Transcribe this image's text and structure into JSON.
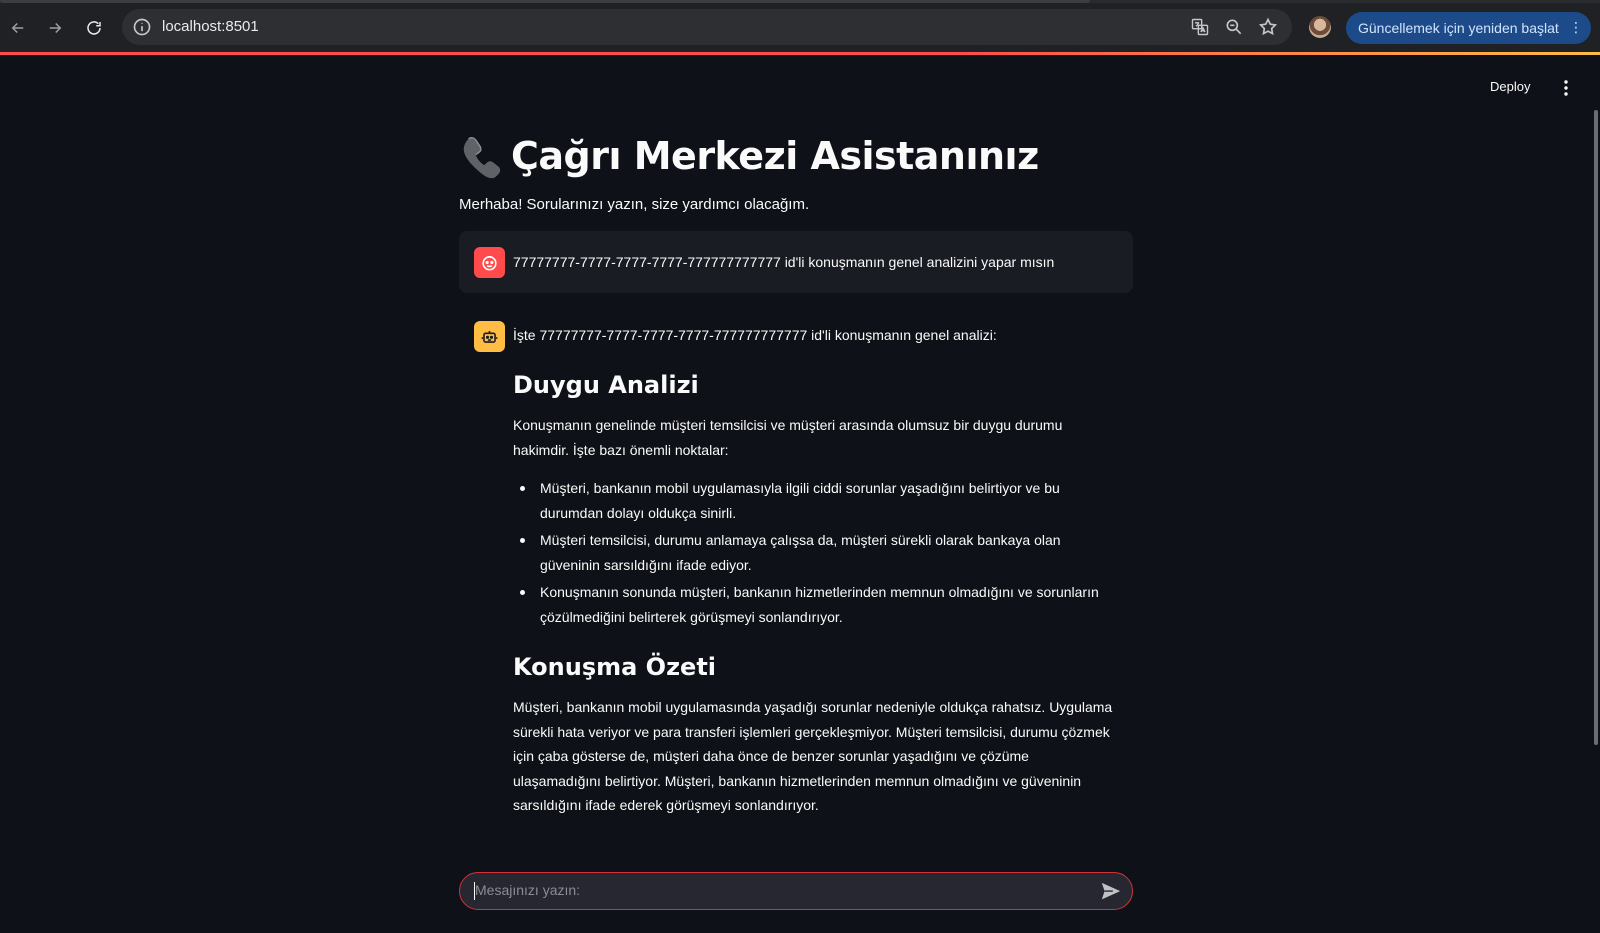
{
  "browser": {
    "url": "localhost:8501",
    "update_button": "Güncellemek için yeniden başlat"
  },
  "header": {
    "deploy_label": "Deploy"
  },
  "page": {
    "title": "Çağrı Merkezi Asistanınız",
    "intro": "Merhaba! Sorularınızı yazın, size yardımcı olacağım."
  },
  "messages": {
    "user": {
      "text": "77777777-7777-7777-7777-777777777777 id'li konuşmanın genel analizini yapar mısın"
    },
    "assistant": {
      "intro": "İşte 77777777-7777-7777-7777-777777777777 id'li konuşmanın genel analizi:",
      "section1_title": "Duygu Analizi",
      "section1_text": "Konuşmanın genelinde müşteri temsilcisi ve müşteri arasında olumsuz bir duygu durumu hakimdir. İşte bazı önemli noktalar:",
      "bullets": [
        "Müşteri, bankanın mobil uygulamasıyla ilgili ciddi sorunlar yaşadığını belirtiyor ve bu durumdan dolayı oldukça sinirli.",
        "Müşteri temsilcisi, durumu anlamaya çalışsa da, müşteri sürekli olarak bankaya olan güveninin sarsıldığını ifade ediyor.",
        "Konuşmanın sonunda müşteri, bankanın hizmetlerinden memnun olmadığını ve sorunların çözülmediğini belirterek görüşmeyi sonlandırıyor."
      ],
      "section2_title": "Konuşma Özeti",
      "section2_text": "Müşteri, bankanın mobil uygulamasında yaşadığı sorunlar nedeniyle oldukça rahatsız. Uygulama sürekli hata veriyor ve para transferi işlemleri gerçekleşmiyor. Müşteri temsilcisi, durumu çözmek için çaba gösterse de, müşteri daha önce de benzer sorunlar yaşadığını ve çözüme ulaşamadığını belirtiyor. Müşteri, bankanın hizmetlerinden memnun olmadığını ve güveninin sarsıldığını ifade ederek görüşmeyi sonlandırıyor."
    }
  },
  "chat_input": {
    "placeholder": "Mesajınızı yazın:"
  },
  "colors": {
    "background": "#0e1117",
    "user_avatar": "#ff4b4b",
    "bot_avatar": "#ffbd45",
    "input_border": "#d2323a"
  },
  "icons": {
    "title": "telephone-receiver-icon",
    "user_avatar": "face-icon",
    "bot_avatar": "robot-icon",
    "send": "send-icon"
  }
}
